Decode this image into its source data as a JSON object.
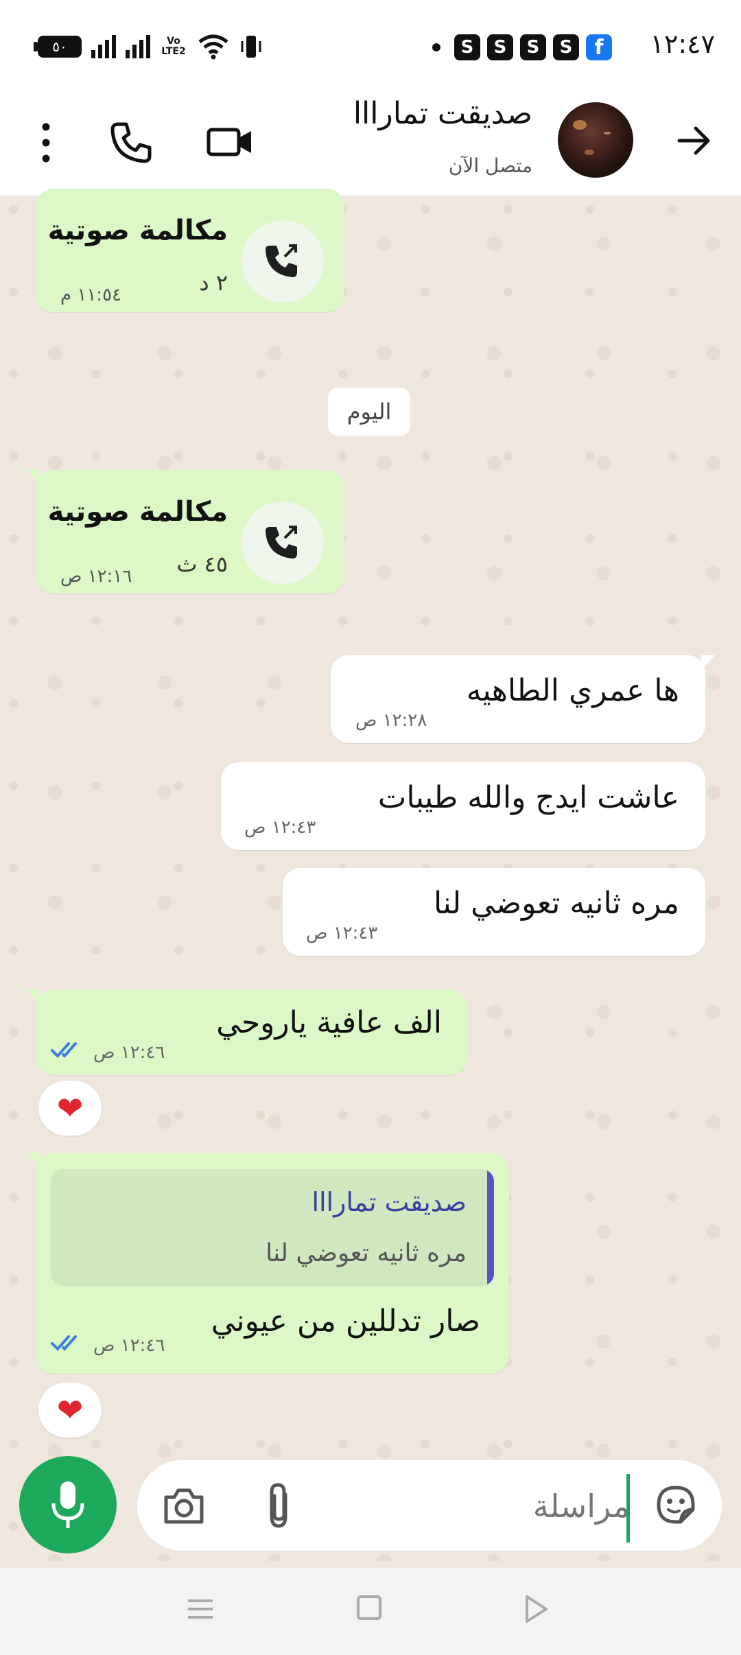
{
  "status_bar": {
    "time": "١٢:٤٧",
    "battery": "٥٠",
    "network_label": "Vo LTE2",
    "notification_s": "S",
    "notification_fb": "f"
  },
  "header": {
    "contact_name": "صديقت تمارااا",
    "contact_status": "متصل الآن"
  },
  "messages": {
    "call1": {
      "title": "مكالمة صوتية",
      "duration": "٢ د",
      "time": "١١:٥٤ م"
    },
    "date_divider": "اليوم",
    "call2": {
      "title": "مكالمة صوتية",
      "duration": "٤٥ ث",
      "time": "١٢:١٦ ص"
    },
    "in1": {
      "text": "ها عمري الطاهيه",
      "time": "١٢:٢٨ ص"
    },
    "in2": {
      "text": "عاشت ايدج والله طيبات",
      "time": "١٢:٤٣ ص"
    },
    "in3": {
      "text": "مره ثانيه تعوضي لنا",
      "time": "١٢:٤٣ ص"
    },
    "out1": {
      "text": "الف عافية ياروحي",
      "time": "١٢:٤٦ ص",
      "reaction": "❤"
    },
    "out2": {
      "quote_author": "صديقت تمارااا",
      "quote_text": "مره ثانيه تعوضي لنا",
      "text": "صار تدللين من عيوني",
      "time": "١٢:٤٦ ص",
      "reaction": "❤"
    }
  },
  "input": {
    "placeholder": "مراسلة",
    "value": ""
  },
  "colors": {
    "outgoing_bubble": "#dcf8c6",
    "incoming_bubble": "#ffffff",
    "accent_green": "#1da95b",
    "read_ticks": "#3b7fd9",
    "quote_bar": "#5a52c7"
  },
  "icons": [
    "back-arrow-icon",
    "video-call-icon",
    "voice-call-icon",
    "menu-icon",
    "outgoing-call-icon",
    "mic-icon",
    "camera-icon",
    "attach-icon",
    "sticker-icon"
  ]
}
